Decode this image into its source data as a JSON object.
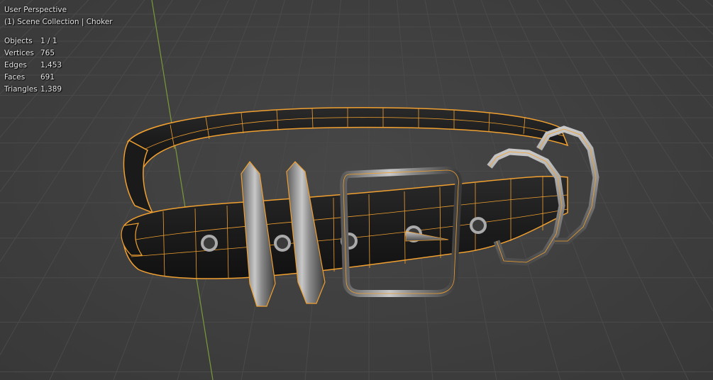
{
  "viewport": {
    "view_name": "User Perspective",
    "collection_line": "(1) Scene Collection | Choker",
    "stats": [
      {
        "label": "Objects",
        "value": "1 / 1"
      },
      {
        "label": "Vertices",
        "value": "765"
      },
      {
        "label": "Edges",
        "value": "1,453"
      },
      {
        "label": "Faces",
        "value": "691"
      },
      {
        "label": "Triangles",
        "value": "1,389"
      }
    ]
  },
  "colors": {
    "background": "#3d3d3d",
    "grid": "#4a4a4a",
    "y_axis": "#7a9a3a",
    "selection_outline": "#f0a030",
    "leather": "#1e1e1e",
    "metal": "#9a9a9a"
  }
}
